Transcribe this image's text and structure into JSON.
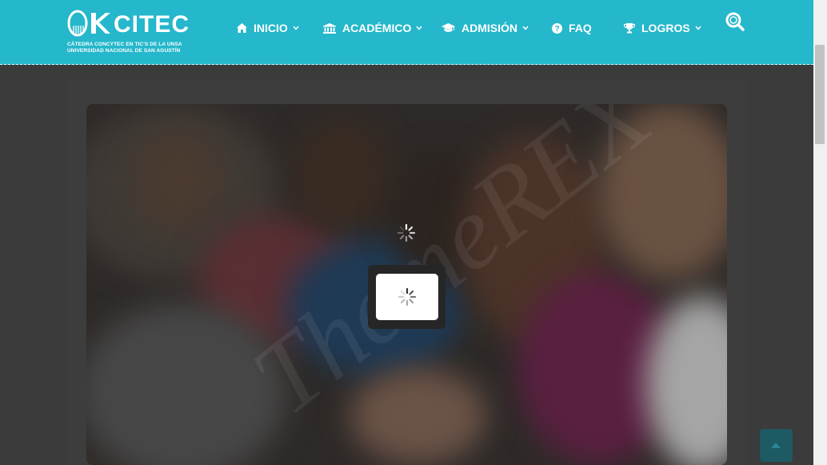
{
  "brand": {
    "name": "CITEC",
    "subtitle_line1": "CÁTEDRA CONCYTEC EN TIC'S DE LA UNSA",
    "subtitle_line2": "UNIVERSIDAD NACIONAL DE SAN AGUSTÍN",
    "header_color": "#25b7cb"
  },
  "nav": {
    "items": [
      {
        "label": "INICIO",
        "icon": "home-icon",
        "has_dropdown": true
      },
      {
        "label": "ACADÉMICO",
        "icon": "university-icon",
        "has_dropdown": true
      },
      {
        "label": "ADMISIÓN",
        "icon": "graduation-cap-icon",
        "has_dropdown": true
      },
      {
        "label": "FAQ",
        "icon": "question-circle-icon",
        "has_dropdown": false
      },
      {
        "label": "LOGROS",
        "icon": "trophy-icon",
        "has_dropdown": true
      }
    ],
    "search_icon": "search-icon"
  },
  "hero": {
    "watermark": "ThemeREX",
    "overlay_color": "#000000"
  },
  "loading": {
    "spinner_icon": "spinner-icon"
  },
  "back_to_top": {
    "icon": "chevron-up-icon",
    "color": "#1d5a63"
  }
}
